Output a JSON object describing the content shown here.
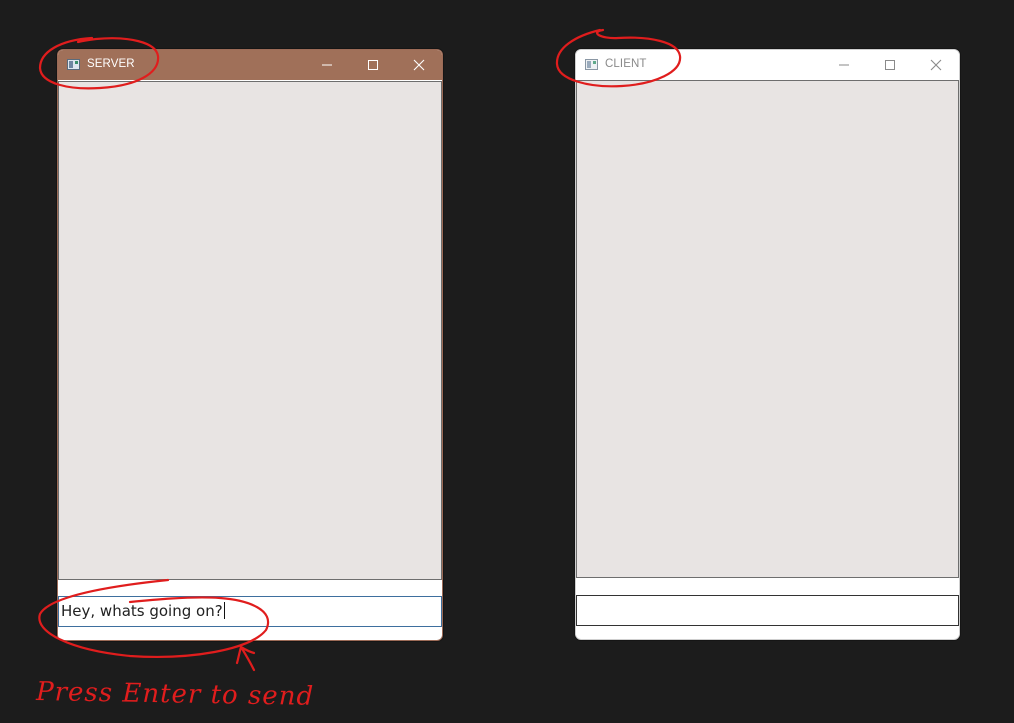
{
  "server_window": {
    "title": "SERVER",
    "input_value": "Hey, whats going on?"
  },
  "client_window": {
    "title": "CLIENT",
    "input_value": ""
  },
  "annotation": {
    "caption": "Press Enter to send"
  },
  "colors": {
    "server_titlebar": "#a07059",
    "chat_area": "#e8e4e3",
    "annotation_red": "#e01d1d",
    "desktop": "#1c1c1c"
  },
  "icons": [
    "app-icon",
    "minimize-icon",
    "maximize-icon",
    "close-icon",
    "arrow-annotation"
  ]
}
